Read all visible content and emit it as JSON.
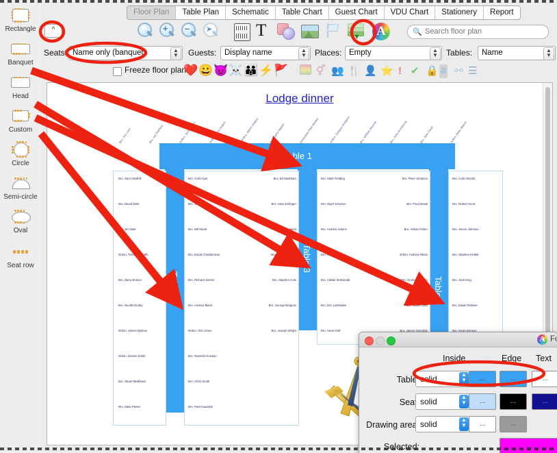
{
  "sidebar": {
    "items": [
      {
        "label": "Rectangle",
        "icon": "rectangle-table-icon"
      },
      {
        "label": "Banquet",
        "icon": "banquet-table-icon"
      },
      {
        "label": "Head",
        "icon": "head-table-icon"
      },
      {
        "label": "Custom",
        "icon": "custom-table-icon"
      },
      {
        "label": "Circle",
        "icon": "circle-table-icon"
      },
      {
        "label": "Semi-circle",
        "icon": "semi-circle-table-icon"
      },
      {
        "label": "Oval",
        "icon": "oval-table-icon"
      },
      {
        "label": "Seat row",
        "icon": "seat-row-icon"
      }
    ]
  },
  "tabs": [
    {
      "label": "Floor Plan",
      "selected": true
    },
    {
      "label": "Table Plan",
      "selected": false
    },
    {
      "label": "Schematic",
      "selected": false
    },
    {
      "label": "Table Chart",
      "selected": false
    },
    {
      "label": "Guest Chart",
      "selected": false
    },
    {
      "label": "VDU Chart",
      "selected": false
    },
    {
      "label": "Stationery",
      "selected": false
    },
    {
      "label": "Report",
      "selected": false
    }
  ],
  "toolbar": {
    "collapse_label": "^",
    "icons": [
      "zoom-fit-icon",
      "zoom-in-icon",
      "zoom-out-icon",
      "zoom-select-icon",
      "ruler-icon",
      "text-icon",
      "shapes-icon",
      "image-icon",
      "flag-icon",
      "layers-icon",
      "fonts-colours-icon"
    ],
    "search": {
      "placeholder": "Search floor plan",
      "value": ""
    }
  },
  "options": {
    "seats_label": "Seats:",
    "seats_value": "Name only (banquet)",
    "guests_label": "Guests:",
    "guests_value": "Display name",
    "places_label": "Places:",
    "places_value": "Empty",
    "tables_label": "Tables:",
    "tables_value": "Name",
    "freeze_label": "Freeze floor plan",
    "freeze_checked": false,
    "emoji_icons": [
      "heart-icon",
      "smiley-icon",
      "purple-face-icon",
      "skull-icon",
      "family-icon",
      "lightning-icon",
      "red-flag-icon"
    ],
    "grey_icons": [
      "gradient-icon",
      "gender-icon",
      "group-icon",
      "cutlery-icon",
      "person-icon",
      "star-icon",
      "exclamation-icon",
      "check-icon",
      "lock-icon",
      "grid-icon",
      "link-icon",
      "list-icon"
    ]
  },
  "plan": {
    "title": "Lodge dinner",
    "tables": [
      {
        "name": "Table 1",
        "orientation": "horizontal"
      },
      {
        "name": "Table 2",
        "orientation": "vertical"
      },
      {
        "name": "Table 3",
        "orientation": "vertical"
      },
      {
        "name": "Table 4",
        "orientation": "vertical"
      }
    ],
    "top_diagonal_names": [
      "Bro. Tim Lord",
      "Bro. Ian Radford",
      "W.Bro. James Allen",
      "W.Bro. Chris Dutton",
      "V.W.Bro. Martin Stokes",
      "Worshipful Master",
      "Immediate Past Master",
      "W.Bro. Gregory Rodgers",
      "Bro. William Munroe",
      "Bro. John Armstrong",
      "Bro. John Dean",
      "W.Bro. Peter Mason"
    ],
    "column_a_names": [
      "Bro. Sam Gledhill",
      "Bro. David Watt",
      "Bro. Jim Dale",
      "W.Bro. Trevor Metcalfe",
      "Bro. Barry Boston",
      "Bro. Neville Dunby",
      "W.Bro. James Marlow",
      "W.Bro. Dennis Smith",
      "Bro. Stuart Matthews",
      "Bro. Mark Parker"
    ],
    "column_b_names": [
      "Bro. Colin Ayer",
      "Bro. Nick Cox",
      "Bro. Bill Stuart",
      "Bro. David Chedderman",
      "Bro. Richard Simms",
      "Bro. Andrew Black",
      "W.Bro. Otis Jones",
      "Bro. Ramesh Hussain",
      "Bro. Chris Smith",
      "Bro. Paul Kowalski"
    ],
    "column_c_names": [
      "Bro. Ed Markham",
      "Bro. Hans Erdinger",
      "Bro. Oliver West",
      "Bro. Justin Malrose",
      "Bro. Stephen Cole",
      "Bro. George Burgess",
      "Bro. Joseph Wright"
    ],
    "column_d_names": [
      "Bro. Mark Fielding",
      "Bro. Nigel Simpson",
      "Bro. Andrew Adams",
      "Bro. Russell White",
      "Bro. Alistair McDonald",
      "Bro. Eric Laithwaite",
      "Bro. Hans Olaf"
    ],
    "column_e_names": [
      "Bro. Peter Simpson",
      "Bro. Paul Newal",
      "Bro. Adrian Fisher",
      "W.Bro. Andrew Atkins",
      "Bro. Gordon Vaughn",
      "Bro. Justin Giles",
      "Bro. James Grenoble"
    ],
    "column_f_names": [
      "Bro. Colin Woods",
      "Bro. Robert Scott",
      "Bro. Simon Johnson",
      "Bro. Stephen Hellab",
      "Bro. Jack King",
      "Bro. Edwin Robson",
      "Bro. Kevin Brinson"
    ]
  },
  "dialog": {
    "title": "Fo",
    "columns": [
      "Inside",
      "Edge",
      "Text"
    ],
    "rows": [
      {
        "label": "Table:",
        "style": "solid",
        "inside_color": "#39a1f2",
        "edge_color": "#39a1f2",
        "text_color": "#ffffff",
        "dots": "..."
      },
      {
        "label": "Seat:",
        "style": "solid",
        "inside_color": "#bfdcf8",
        "edge_color": "#000000",
        "text_color": "#101090",
        "dots": "..."
      },
      {
        "label": "Drawing area:",
        "style": "solid",
        "inside_color": "#ffffff",
        "edge_color": "#9b9b9b",
        "text_color": null,
        "dots": "..."
      },
      {
        "label": "Selected:",
        "style": null,
        "inside_color": null,
        "edge_color": null,
        "text_color": "#ff00ff",
        "dots": "..."
      }
    ]
  },
  "annotations": {
    "highlight_color": "#ee2211",
    "ovals": [
      "collapse-button",
      "seats-dropdown",
      "fonts-colours-toolbar-icon",
      "table-row-in-dialog"
    ],
    "arrow_count": 4
  }
}
